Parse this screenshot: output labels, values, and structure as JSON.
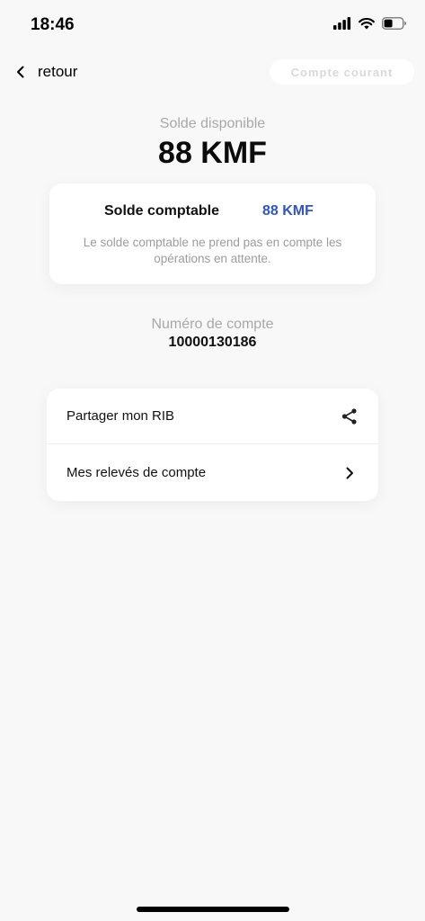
{
  "status_bar": {
    "time": "18:46",
    "icons": [
      "cellular-signal-icon",
      "wifi-icon",
      "battery-icon"
    ]
  },
  "nav": {
    "back_label": "retour",
    "account_type": "Compte courant"
  },
  "balance": {
    "label": "Solde disponible",
    "value": "88 KMF"
  },
  "accounting": {
    "label": "Solde comptable",
    "value": "88 KMF",
    "note": "Le solde comptable ne prend pas en compte les opérations en attente."
  },
  "account_number": {
    "label": "Numéro de compte",
    "value": "10000130186"
  },
  "actions": [
    {
      "label": "Partager mon RIB",
      "icon": "share-icon"
    },
    {
      "label": "Mes relevés de compte",
      "icon": "chevron-right-icon"
    }
  ],
  "colors": {
    "accent": "#2e55c9",
    "background": "#f8f8f8",
    "muted_text": "#a8a8a8"
  }
}
